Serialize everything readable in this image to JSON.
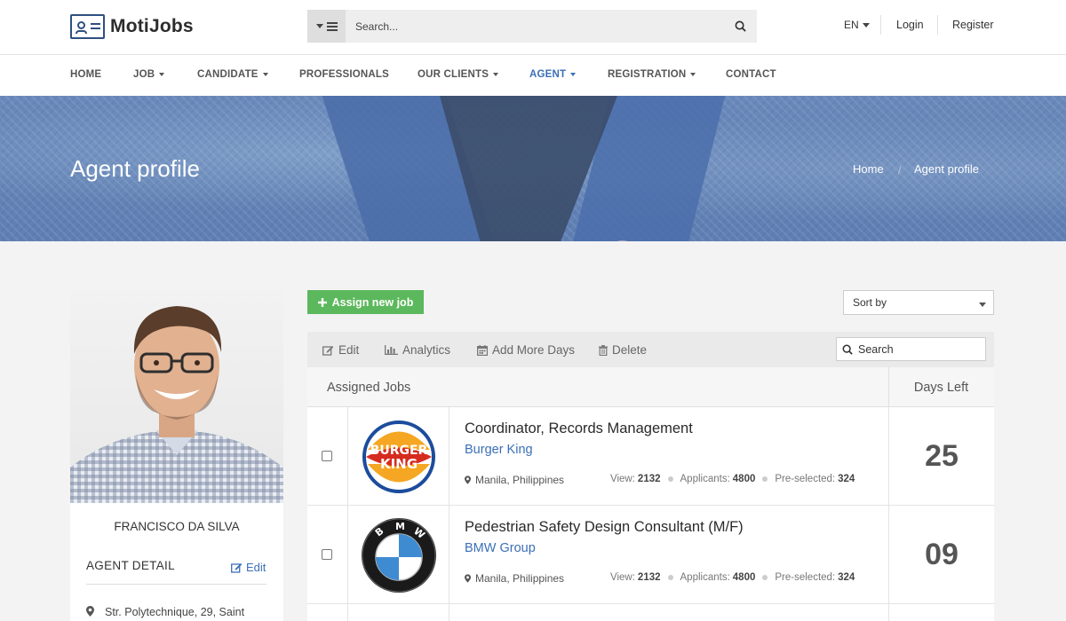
{
  "brand": {
    "name": "MotiJobs"
  },
  "search": {
    "placeholder": "Search..."
  },
  "header": {
    "lang": "EN",
    "login": "Login",
    "register": "Register"
  },
  "nav": {
    "items": [
      {
        "label": "HOME",
        "dropdown": false
      },
      {
        "label": "JOB",
        "dropdown": true
      },
      {
        "label": "CANDIDATE",
        "dropdown": true
      },
      {
        "label": "PROFESSIONALS",
        "dropdown": false
      },
      {
        "label": "OUR CLIENTS",
        "dropdown": true
      },
      {
        "label": "AGENT",
        "dropdown": true,
        "active": true
      },
      {
        "label": "REGISTRATION",
        "dropdown": true
      },
      {
        "label": "CONTACT",
        "dropdown": false
      }
    ]
  },
  "hero": {
    "title": "Agent profile",
    "breadcrumb": [
      "Home",
      "/",
      "Agent profile"
    ]
  },
  "profile": {
    "name": "FRANCISCO DA SILVA",
    "detail_heading": "AGENT DETAIL",
    "edit_label": "Edit",
    "address": "Str. Polytechnique, 29, Saint"
  },
  "actions": {
    "assign_label": "Assign new job",
    "sort_label": "Sort by"
  },
  "toolbar": {
    "edit": "Edit",
    "analytics": "Analytics",
    "add_days": "Add More Days",
    "delete": "Delete",
    "search_placeholder": "Search"
  },
  "table": {
    "col_jobs": "Assigned Jobs",
    "col_days": "Days Left",
    "rows": [
      {
        "title": "Coordinator, Records Management",
        "company": "Burger King",
        "location": "Manila, Philippines",
        "view_label": "View:",
        "views": "2132",
        "applicants_label": "Applicants:",
        "applicants": "4800",
        "preselected_label": "Pre-selected:",
        "preselected": "324",
        "days": "25",
        "logo": "burger-king-logo"
      },
      {
        "title": "Pedestrian Safety Design Consultant (M/F)",
        "company": "BMW Group",
        "location": "Manila, Philippines",
        "view_label": "View:",
        "views": "2132",
        "applicants_label": "Applicants:",
        "applicants": "4800",
        "preselected_label": "Pre-selected:",
        "preselected": "324",
        "days": "09",
        "logo": "bmw-logo"
      }
    ]
  },
  "colors": {
    "accent": "#3b6fb6",
    "green": "#5cb85c",
    "brand": "#2f4f7f"
  }
}
